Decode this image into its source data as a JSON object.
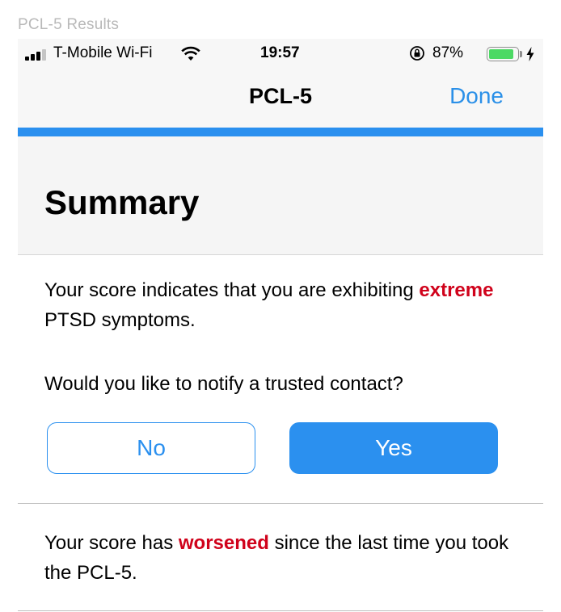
{
  "caption": "PCL-5 Results",
  "status_bar": {
    "carrier": "T-Mobile Wi-Fi",
    "time": "19:57",
    "battery_percent": "87%",
    "battery_level": 0.87,
    "battery_color": "#4cd964",
    "icons": [
      "signal-bars-icon",
      "wifi-icon",
      "orientation-lock-icon",
      "battery-icon",
      "charging-bolt-icon"
    ]
  },
  "navbar": {
    "title": "PCL-5",
    "done_label": "Done"
  },
  "progress": {
    "value": 1.0,
    "color": "#2b90ef"
  },
  "summary": {
    "title": "Summary",
    "severity": {
      "prefix": "Your score indicates that you are exhibiting ",
      "highlight": "extreme",
      "suffix": " PTSD symptoms."
    },
    "notify_question": "Would you like to notify a trusted contact?",
    "no_label": "No",
    "yes_label": "Yes",
    "trend": {
      "prefix": "Your score has ",
      "highlight": "worsened",
      "suffix": " since the last time you took the PCL-5."
    }
  },
  "colors": {
    "accent": "#2b90ef",
    "alert": "#d0021b"
  }
}
